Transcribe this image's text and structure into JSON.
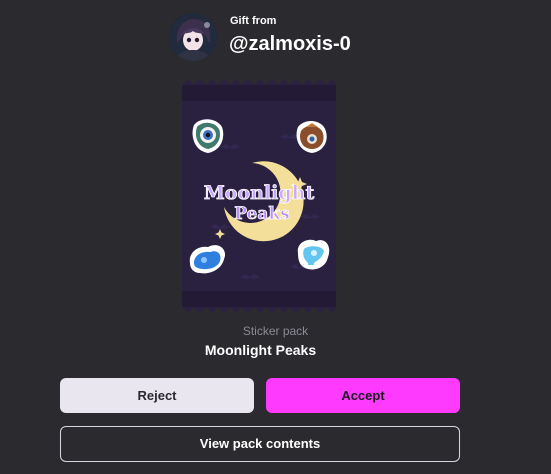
{
  "gift": {
    "header_label": "Gift from",
    "sender_username": "@zalmoxis-0"
  },
  "pack": {
    "type_label": "Sticker pack",
    "name": "Moonlight Peaks",
    "logo_line1": "Moonlight",
    "logo_line2": "Peaks"
  },
  "actions": {
    "reject_label": "Reject",
    "accept_label": "Accept",
    "view_contents_label": "View pack contents"
  },
  "colors": {
    "background": "#2b2a2f",
    "accept": "#ff3aff",
    "reject": "#e9e6ef",
    "pack": "#2a2140"
  }
}
